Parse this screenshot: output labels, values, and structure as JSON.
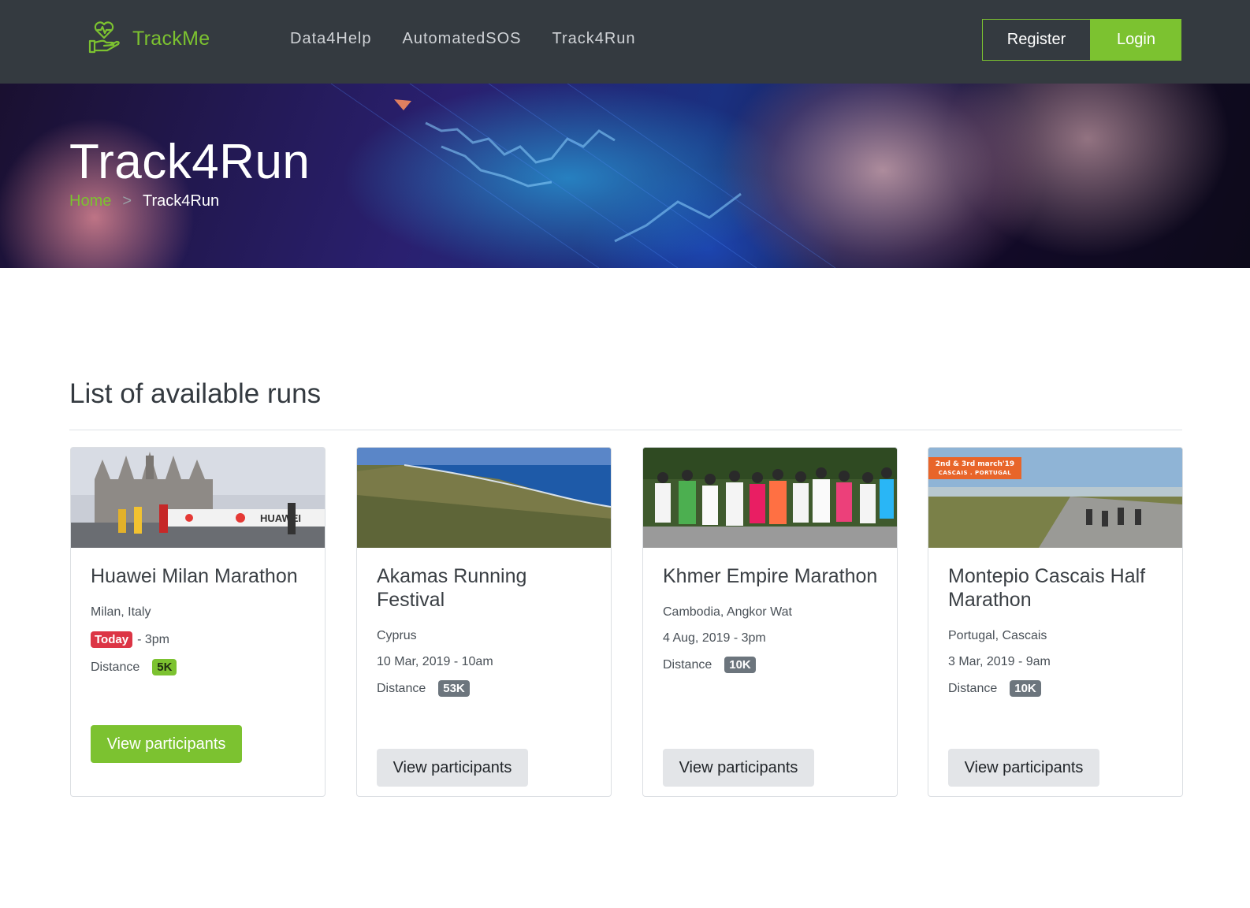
{
  "navbar": {
    "brand": "TrackMe",
    "links": [
      "Data4Help",
      "AutomatedSOS",
      "Track4Run"
    ],
    "register_label": "Register",
    "login_label": "Login",
    "accent_color": "#7cc230",
    "logo_icon": "heart-hand-icon"
  },
  "hero": {
    "title": "Track4Run",
    "breadcrumb": {
      "home": "Home",
      "separator": ">",
      "current": "Track4Run"
    }
  },
  "runs_section": {
    "title": "List of available runs",
    "runs": [
      {
        "name": "Huawei Milan Marathon",
        "location": "Milan, Italy",
        "today_badge": "Today",
        "date": "- 3pm",
        "distance_label": "Distance",
        "distance": "5K",
        "button": "View participants"
      },
      {
        "name": "Akamas Running Festival",
        "location": "Cyprus",
        "date": "10 Mar, 2019 - 10am",
        "distance_label": "Distance",
        "distance": "53K",
        "button": "View participants"
      },
      {
        "name": "Khmer Empire Marathon",
        "location": "Cambodia, Angkor Wat",
        "date": "4 Aug, 2019 - 3pm",
        "distance_label": "Distance",
        "distance": "10K",
        "button": "View participants"
      },
      {
        "name": "Montepio Cascais Half Marathon",
        "location": "Portugal, Cascais",
        "date": "3 Mar, 2019 - 9am",
        "distance_label": "Distance",
        "distance": "10K",
        "button": "View participants",
        "image_banner": [
          "2nd & 3rd march'19",
          "CASCAIS . PORTUGAL"
        ]
      }
    ]
  }
}
